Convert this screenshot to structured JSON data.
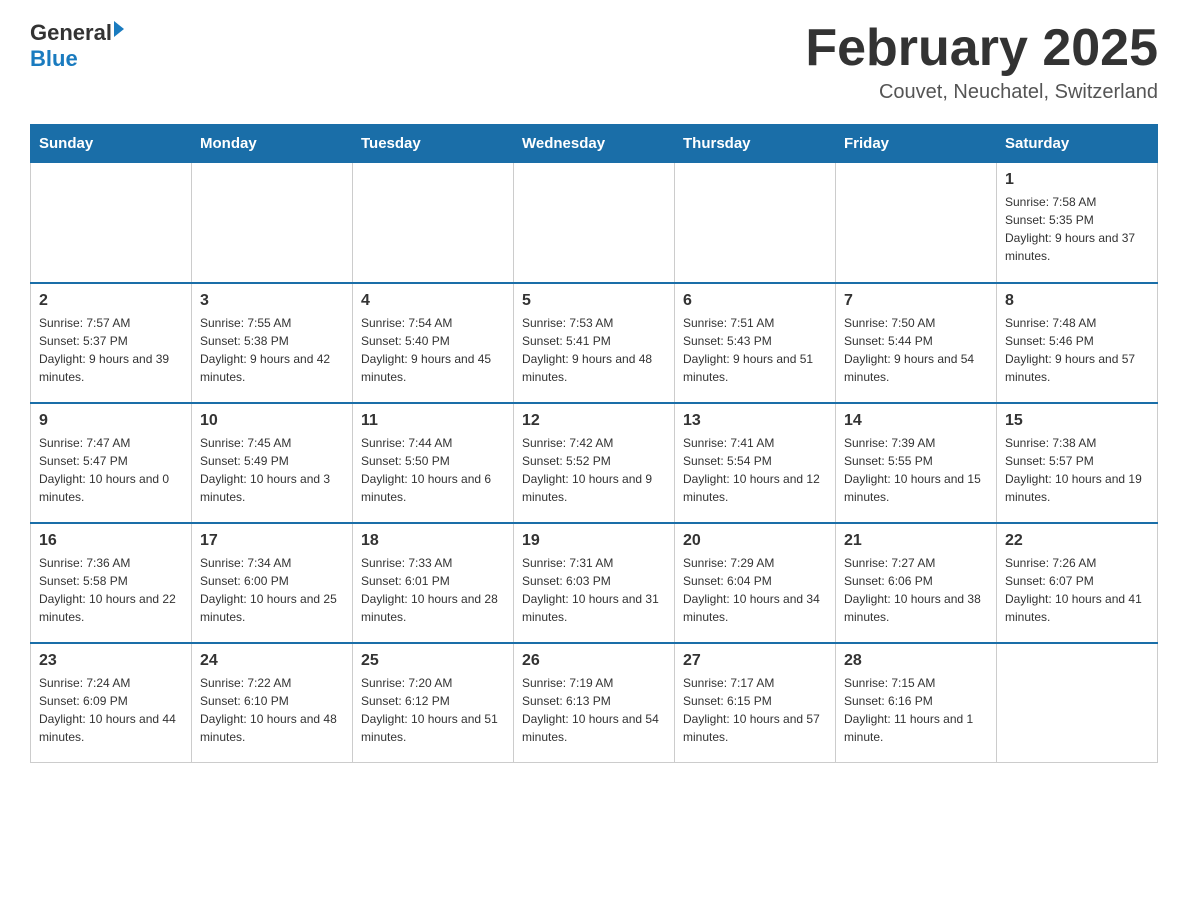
{
  "header": {
    "logo_general": "General",
    "logo_blue": "Blue",
    "title": "February 2025",
    "subtitle": "Couvet, Neuchatel, Switzerland"
  },
  "days_of_week": [
    "Sunday",
    "Monday",
    "Tuesday",
    "Wednesday",
    "Thursday",
    "Friday",
    "Saturday"
  ],
  "weeks": [
    [
      {
        "day": "",
        "sunrise": "",
        "sunset": "",
        "daylight": ""
      },
      {
        "day": "",
        "sunrise": "",
        "sunset": "",
        "daylight": ""
      },
      {
        "day": "",
        "sunrise": "",
        "sunset": "",
        "daylight": ""
      },
      {
        "day": "",
        "sunrise": "",
        "sunset": "",
        "daylight": ""
      },
      {
        "day": "",
        "sunrise": "",
        "sunset": "",
        "daylight": ""
      },
      {
        "day": "",
        "sunrise": "",
        "sunset": "",
        "daylight": ""
      },
      {
        "day": "1",
        "sunrise": "Sunrise: 7:58 AM",
        "sunset": "Sunset: 5:35 PM",
        "daylight": "Daylight: 9 hours and 37 minutes."
      }
    ],
    [
      {
        "day": "2",
        "sunrise": "Sunrise: 7:57 AM",
        "sunset": "Sunset: 5:37 PM",
        "daylight": "Daylight: 9 hours and 39 minutes."
      },
      {
        "day": "3",
        "sunrise": "Sunrise: 7:55 AM",
        "sunset": "Sunset: 5:38 PM",
        "daylight": "Daylight: 9 hours and 42 minutes."
      },
      {
        "day": "4",
        "sunrise": "Sunrise: 7:54 AM",
        "sunset": "Sunset: 5:40 PM",
        "daylight": "Daylight: 9 hours and 45 minutes."
      },
      {
        "day": "5",
        "sunrise": "Sunrise: 7:53 AM",
        "sunset": "Sunset: 5:41 PM",
        "daylight": "Daylight: 9 hours and 48 minutes."
      },
      {
        "day": "6",
        "sunrise": "Sunrise: 7:51 AM",
        "sunset": "Sunset: 5:43 PM",
        "daylight": "Daylight: 9 hours and 51 minutes."
      },
      {
        "day": "7",
        "sunrise": "Sunrise: 7:50 AM",
        "sunset": "Sunset: 5:44 PM",
        "daylight": "Daylight: 9 hours and 54 minutes."
      },
      {
        "day": "8",
        "sunrise": "Sunrise: 7:48 AM",
        "sunset": "Sunset: 5:46 PM",
        "daylight": "Daylight: 9 hours and 57 minutes."
      }
    ],
    [
      {
        "day": "9",
        "sunrise": "Sunrise: 7:47 AM",
        "sunset": "Sunset: 5:47 PM",
        "daylight": "Daylight: 10 hours and 0 minutes."
      },
      {
        "day": "10",
        "sunrise": "Sunrise: 7:45 AM",
        "sunset": "Sunset: 5:49 PM",
        "daylight": "Daylight: 10 hours and 3 minutes."
      },
      {
        "day": "11",
        "sunrise": "Sunrise: 7:44 AM",
        "sunset": "Sunset: 5:50 PM",
        "daylight": "Daylight: 10 hours and 6 minutes."
      },
      {
        "day": "12",
        "sunrise": "Sunrise: 7:42 AM",
        "sunset": "Sunset: 5:52 PM",
        "daylight": "Daylight: 10 hours and 9 minutes."
      },
      {
        "day": "13",
        "sunrise": "Sunrise: 7:41 AM",
        "sunset": "Sunset: 5:54 PM",
        "daylight": "Daylight: 10 hours and 12 minutes."
      },
      {
        "day": "14",
        "sunrise": "Sunrise: 7:39 AM",
        "sunset": "Sunset: 5:55 PM",
        "daylight": "Daylight: 10 hours and 15 minutes."
      },
      {
        "day": "15",
        "sunrise": "Sunrise: 7:38 AM",
        "sunset": "Sunset: 5:57 PM",
        "daylight": "Daylight: 10 hours and 19 minutes."
      }
    ],
    [
      {
        "day": "16",
        "sunrise": "Sunrise: 7:36 AM",
        "sunset": "Sunset: 5:58 PM",
        "daylight": "Daylight: 10 hours and 22 minutes."
      },
      {
        "day": "17",
        "sunrise": "Sunrise: 7:34 AM",
        "sunset": "Sunset: 6:00 PM",
        "daylight": "Daylight: 10 hours and 25 minutes."
      },
      {
        "day": "18",
        "sunrise": "Sunrise: 7:33 AM",
        "sunset": "Sunset: 6:01 PM",
        "daylight": "Daylight: 10 hours and 28 minutes."
      },
      {
        "day": "19",
        "sunrise": "Sunrise: 7:31 AM",
        "sunset": "Sunset: 6:03 PM",
        "daylight": "Daylight: 10 hours and 31 minutes."
      },
      {
        "day": "20",
        "sunrise": "Sunrise: 7:29 AM",
        "sunset": "Sunset: 6:04 PM",
        "daylight": "Daylight: 10 hours and 34 minutes."
      },
      {
        "day": "21",
        "sunrise": "Sunrise: 7:27 AM",
        "sunset": "Sunset: 6:06 PM",
        "daylight": "Daylight: 10 hours and 38 minutes."
      },
      {
        "day": "22",
        "sunrise": "Sunrise: 7:26 AM",
        "sunset": "Sunset: 6:07 PM",
        "daylight": "Daylight: 10 hours and 41 minutes."
      }
    ],
    [
      {
        "day": "23",
        "sunrise": "Sunrise: 7:24 AM",
        "sunset": "Sunset: 6:09 PM",
        "daylight": "Daylight: 10 hours and 44 minutes."
      },
      {
        "day": "24",
        "sunrise": "Sunrise: 7:22 AM",
        "sunset": "Sunset: 6:10 PM",
        "daylight": "Daylight: 10 hours and 48 minutes."
      },
      {
        "day": "25",
        "sunrise": "Sunrise: 7:20 AM",
        "sunset": "Sunset: 6:12 PM",
        "daylight": "Daylight: 10 hours and 51 minutes."
      },
      {
        "day": "26",
        "sunrise": "Sunrise: 7:19 AM",
        "sunset": "Sunset: 6:13 PM",
        "daylight": "Daylight: 10 hours and 54 minutes."
      },
      {
        "day": "27",
        "sunrise": "Sunrise: 7:17 AM",
        "sunset": "Sunset: 6:15 PM",
        "daylight": "Daylight: 10 hours and 57 minutes."
      },
      {
        "day": "28",
        "sunrise": "Sunrise: 7:15 AM",
        "sunset": "Sunset: 6:16 PM",
        "daylight": "Daylight: 11 hours and 1 minute."
      },
      {
        "day": "",
        "sunrise": "",
        "sunset": "",
        "daylight": ""
      }
    ]
  ]
}
